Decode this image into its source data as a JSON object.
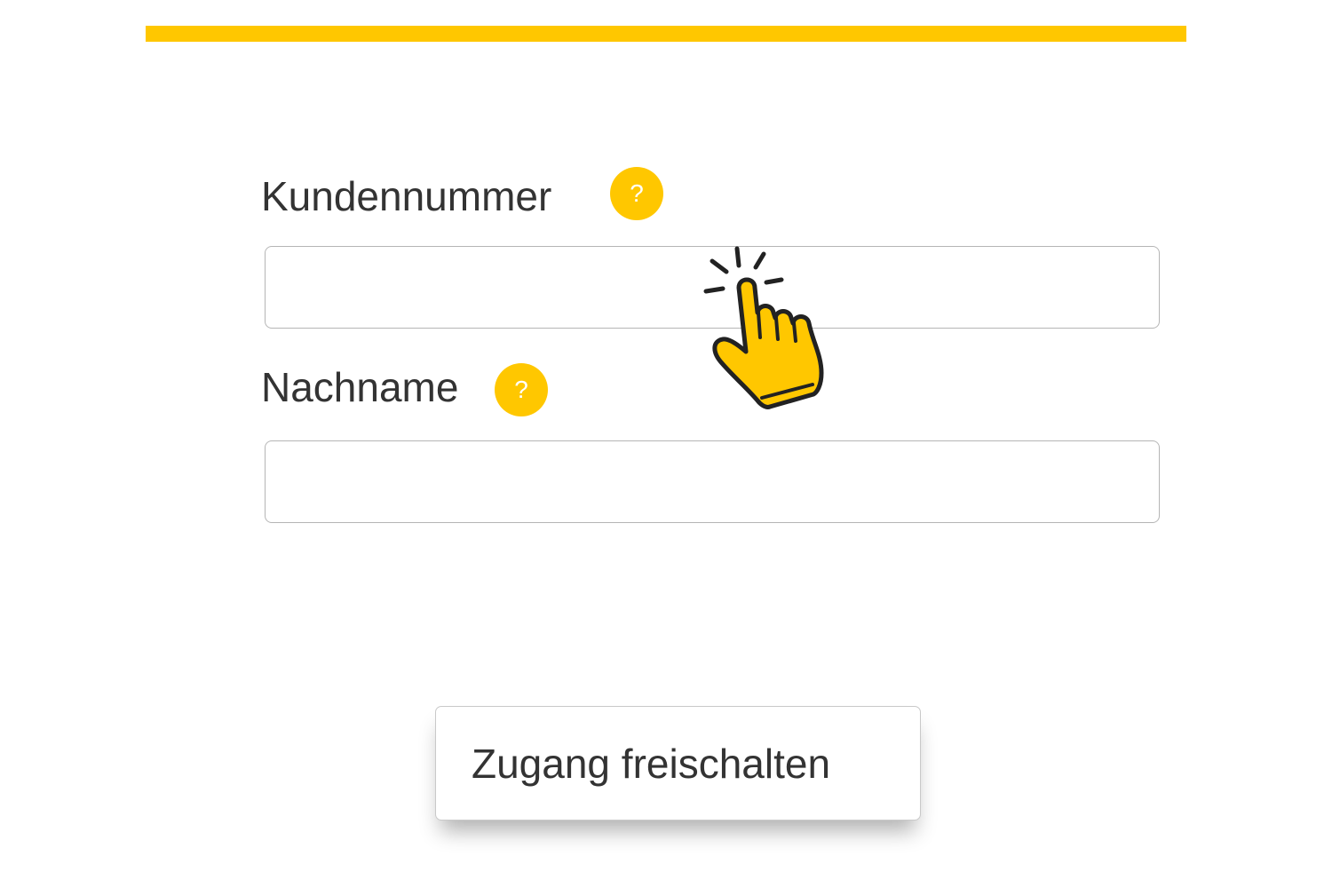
{
  "colors": {
    "accent": "#FFC700",
    "text": "#333333",
    "input_border": "#b5b5b5"
  },
  "form": {
    "customer_number": {
      "label": "Kundennummer",
      "help_symbol": "?",
      "value": ""
    },
    "last_name": {
      "label": "Nachname",
      "help_symbol": "?",
      "value": ""
    },
    "submit_label": "Zugang freischalten"
  },
  "icons": {
    "help": "question-mark-icon",
    "cursor": "pointing-hand-click-icon"
  }
}
